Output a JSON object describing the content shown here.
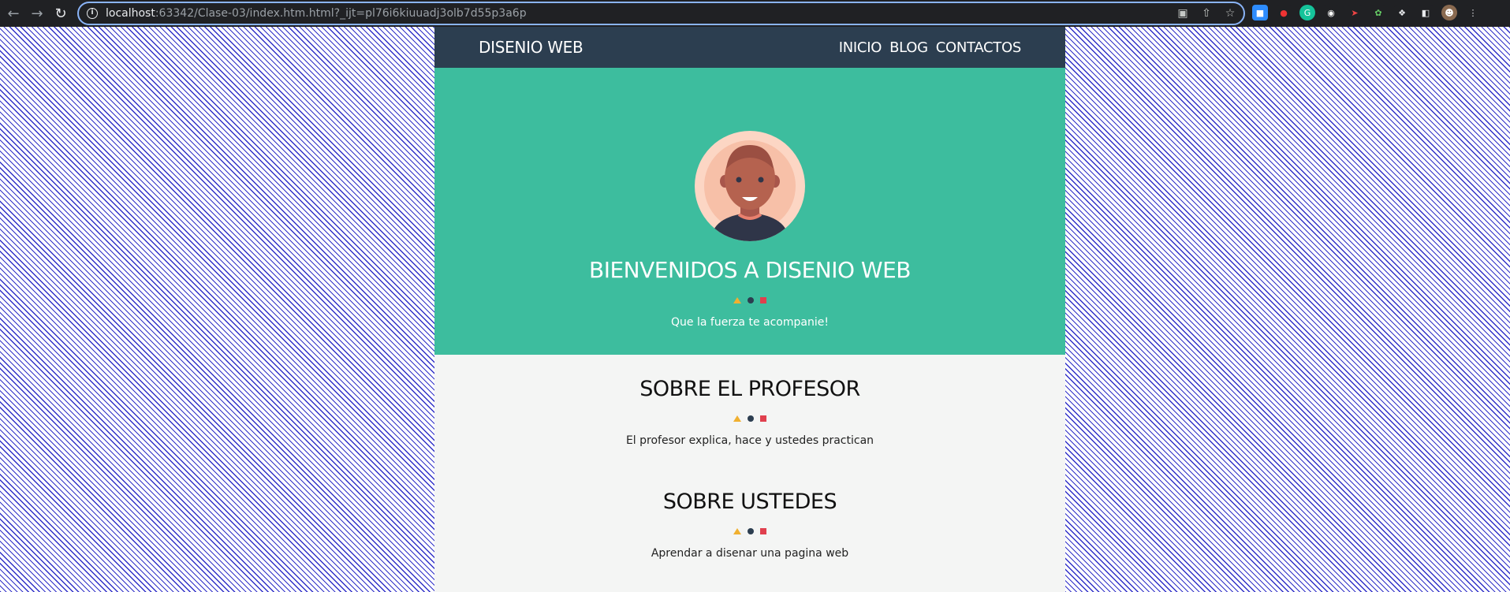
{
  "browser": {
    "url_host": "localhost",
    "url_rest": ":63342/Clase-03/index.htm.html?_ijt=pl76i6kiuuadj3olb7d55p3a6p"
  },
  "site": {
    "brand": "DISENIO WEB",
    "menu": [
      "INICIO",
      "BLOG",
      "CONTACTOS"
    ],
    "hero": {
      "title": "BIENVENIDOS A DISENIO WEB",
      "subtitle": "Que la fuerza te acompanie!"
    },
    "sections": [
      {
        "title": "SOBRE EL PROFESOR",
        "text": "El profesor explica, hace y ustedes practican"
      },
      {
        "title": "SOBRE USTEDES",
        "text": "Aprendar a disenar una pagina web"
      }
    ]
  },
  "colors": {
    "header_bg": "#2c3e50",
    "hero_bg": "#3dbd9e",
    "page_bg": "#f4f5f4",
    "triangle": "#f0b030",
    "circle": "#2c3e50",
    "square": "#e0404e",
    "stripes": "#3030c8"
  }
}
